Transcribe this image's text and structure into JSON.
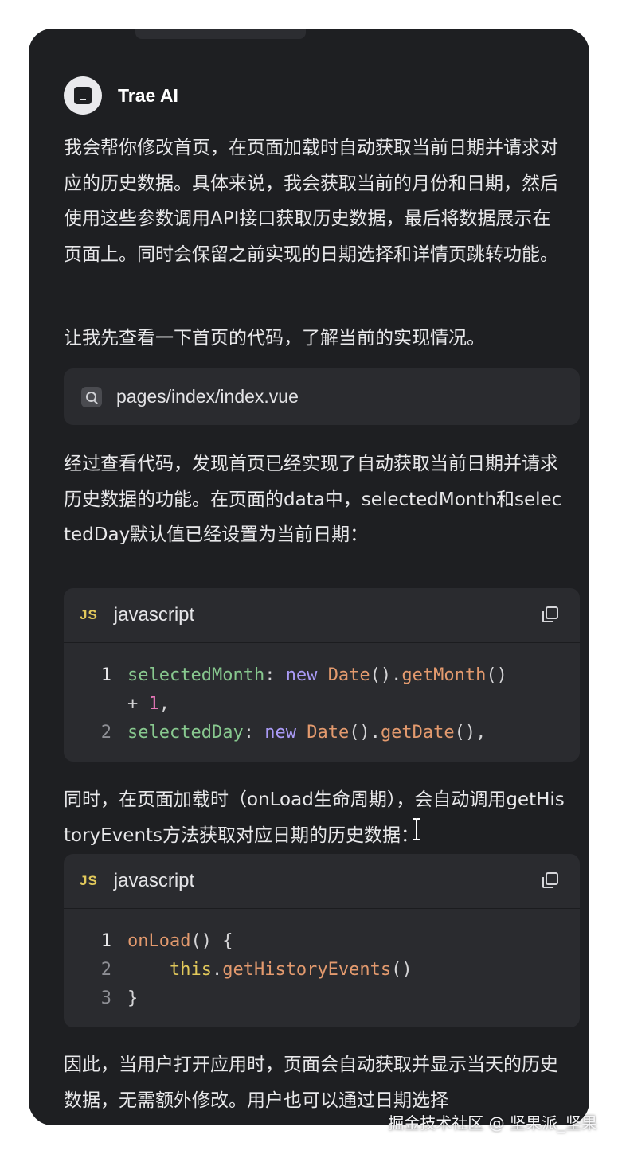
{
  "assistant": {
    "name": "Trae AI"
  },
  "messages": {
    "intro": "我会帮你修改首页，在页面加载时自动获取当前日期并请求对应的历史数据。具体来说，我会获取当前的月份和日期，然后使用这些参数调用API接口获取历史数据，最后将数据展示在页面上。同时会保留之前实现的日期选择和详情页跳转功能。",
    "check": "让我先查看一下首页的代码，了解当前的实现情况。",
    "after_review": "经过查看代码，发现首页已经实现了自动获取当前日期并请求历史数据的功能。在页面的data中，selectedMonth和selectedDay默认值已经设置为当前日期：",
    "onload": "同时，在页面加载时（onLoad生命周期），会自动调用getHistoryEvents方法获取对应日期的历史数据：",
    "conclusion": "因此，当用户打开应用时，页面会自动获取并显示当天的历史数据，无需额外修改。用户也可以通过日期选择"
  },
  "file_ref": {
    "icon": "search-icon",
    "path": "pages/index/index.vue"
  },
  "code_blocks": [
    {
      "lang_badge": "JS",
      "lang": "javascript",
      "lines": [
        {
          "n": "1",
          "segments": [
            [
              "prop",
              "selectedMonth"
            ],
            [
              "plain",
              ": "
            ],
            [
              "kw",
              "new"
            ],
            [
              "plain",
              " "
            ],
            [
              "cls",
              "Date"
            ],
            [
              "plain",
              "()."
            ],
            [
              "fn",
              "getMonth"
            ],
            [
              "plain",
              "()"
            ]
          ]
        },
        {
          "n": "",
          "segments": [
            [
              "plain",
              "+ "
            ],
            [
              "num",
              "1"
            ],
            [
              "plain",
              ","
            ]
          ]
        },
        {
          "n": "2",
          "segments": [
            [
              "prop",
              "selectedDay"
            ],
            [
              "plain",
              ": "
            ],
            [
              "kw",
              "new"
            ],
            [
              "plain",
              " "
            ],
            [
              "cls",
              "Date"
            ],
            [
              "plain",
              "()."
            ],
            [
              "fn",
              "getDate"
            ],
            [
              "plain",
              "(),"
            ]
          ]
        }
      ]
    },
    {
      "lang_badge": "JS",
      "lang": "javascript",
      "lines": [
        {
          "n": "1",
          "segments": [
            [
              "fn",
              "onLoad"
            ],
            [
              "plain",
              "() {"
            ]
          ]
        },
        {
          "n": "2",
          "segments": [
            [
              "plain",
              "    "
            ],
            [
              "this",
              "this"
            ],
            [
              "plain",
              "."
            ],
            [
              "fn",
              "getHistoryEvents"
            ],
            [
              "plain",
              "()"
            ]
          ]
        },
        {
          "n": "3",
          "segments": [
            [
              "plain",
              "}"
            ]
          ]
        }
      ]
    }
  ],
  "watermark": "掘金技术社区 @ 坚果派_坚果",
  "colors": {
    "panel_bg": "#1e1f22",
    "block_bg": "#2a2b2f",
    "text": "#e8e8ea",
    "keyword": "#a99af5",
    "property": "#88c98f",
    "function": "#e39a6e",
    "number": "#e677b8",
    "js_badge": "#e2c95b"
  }
}
